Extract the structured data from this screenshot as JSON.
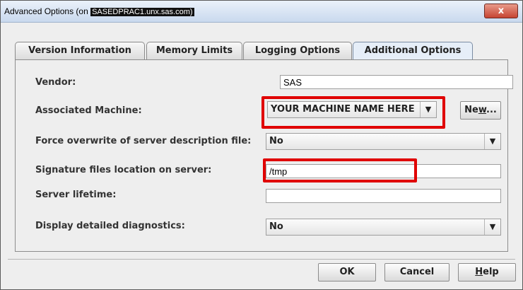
{
  "window": {
    "title_prefix": "Advanced Options (on ",
    "title_redacted": "SASEDPRAC1.unx.sas.com)",
    "close_glyph": "x"
  },
  "tabs": [
    {
      "label": "Version Information"
    },
    {
      "label": "Memory Limits"
    },
    {
      "label": "Logging Options"
    },
    {
      "label": "Additional Options",
      "active": true
    }
  ],
  "form": {
    "vendor_label": "Vendor:",
    "vendor_value": "SAS",
    "machine_label": "Associated Machine:",
    "machine_value": "YOUR MACHINE NAME HERE",
    "new_button_pre": "Ne",
    "new_button_mnemonic": "w",
    "new_button_post": "...",
    "force_label": "Force overwrite of server description file:",
    "force_value": "No",
    "signature_label": "Signature files location on server:",
    "signature_value": "/tmp",
    "lifetime_label": "Server lifetime:",
    "lifetime_value": "",
    "diagnostics_label": "Display detailed diagnostics:",
    "diagnostics_value": "No"
  },
  "buttons": {
    "ok": "OK",
    "cancel": "Cancel",
    "help_mnemonic": "H",
    "help_rest": "elp"
  },
  "annotation_color": "#e00000"
}
